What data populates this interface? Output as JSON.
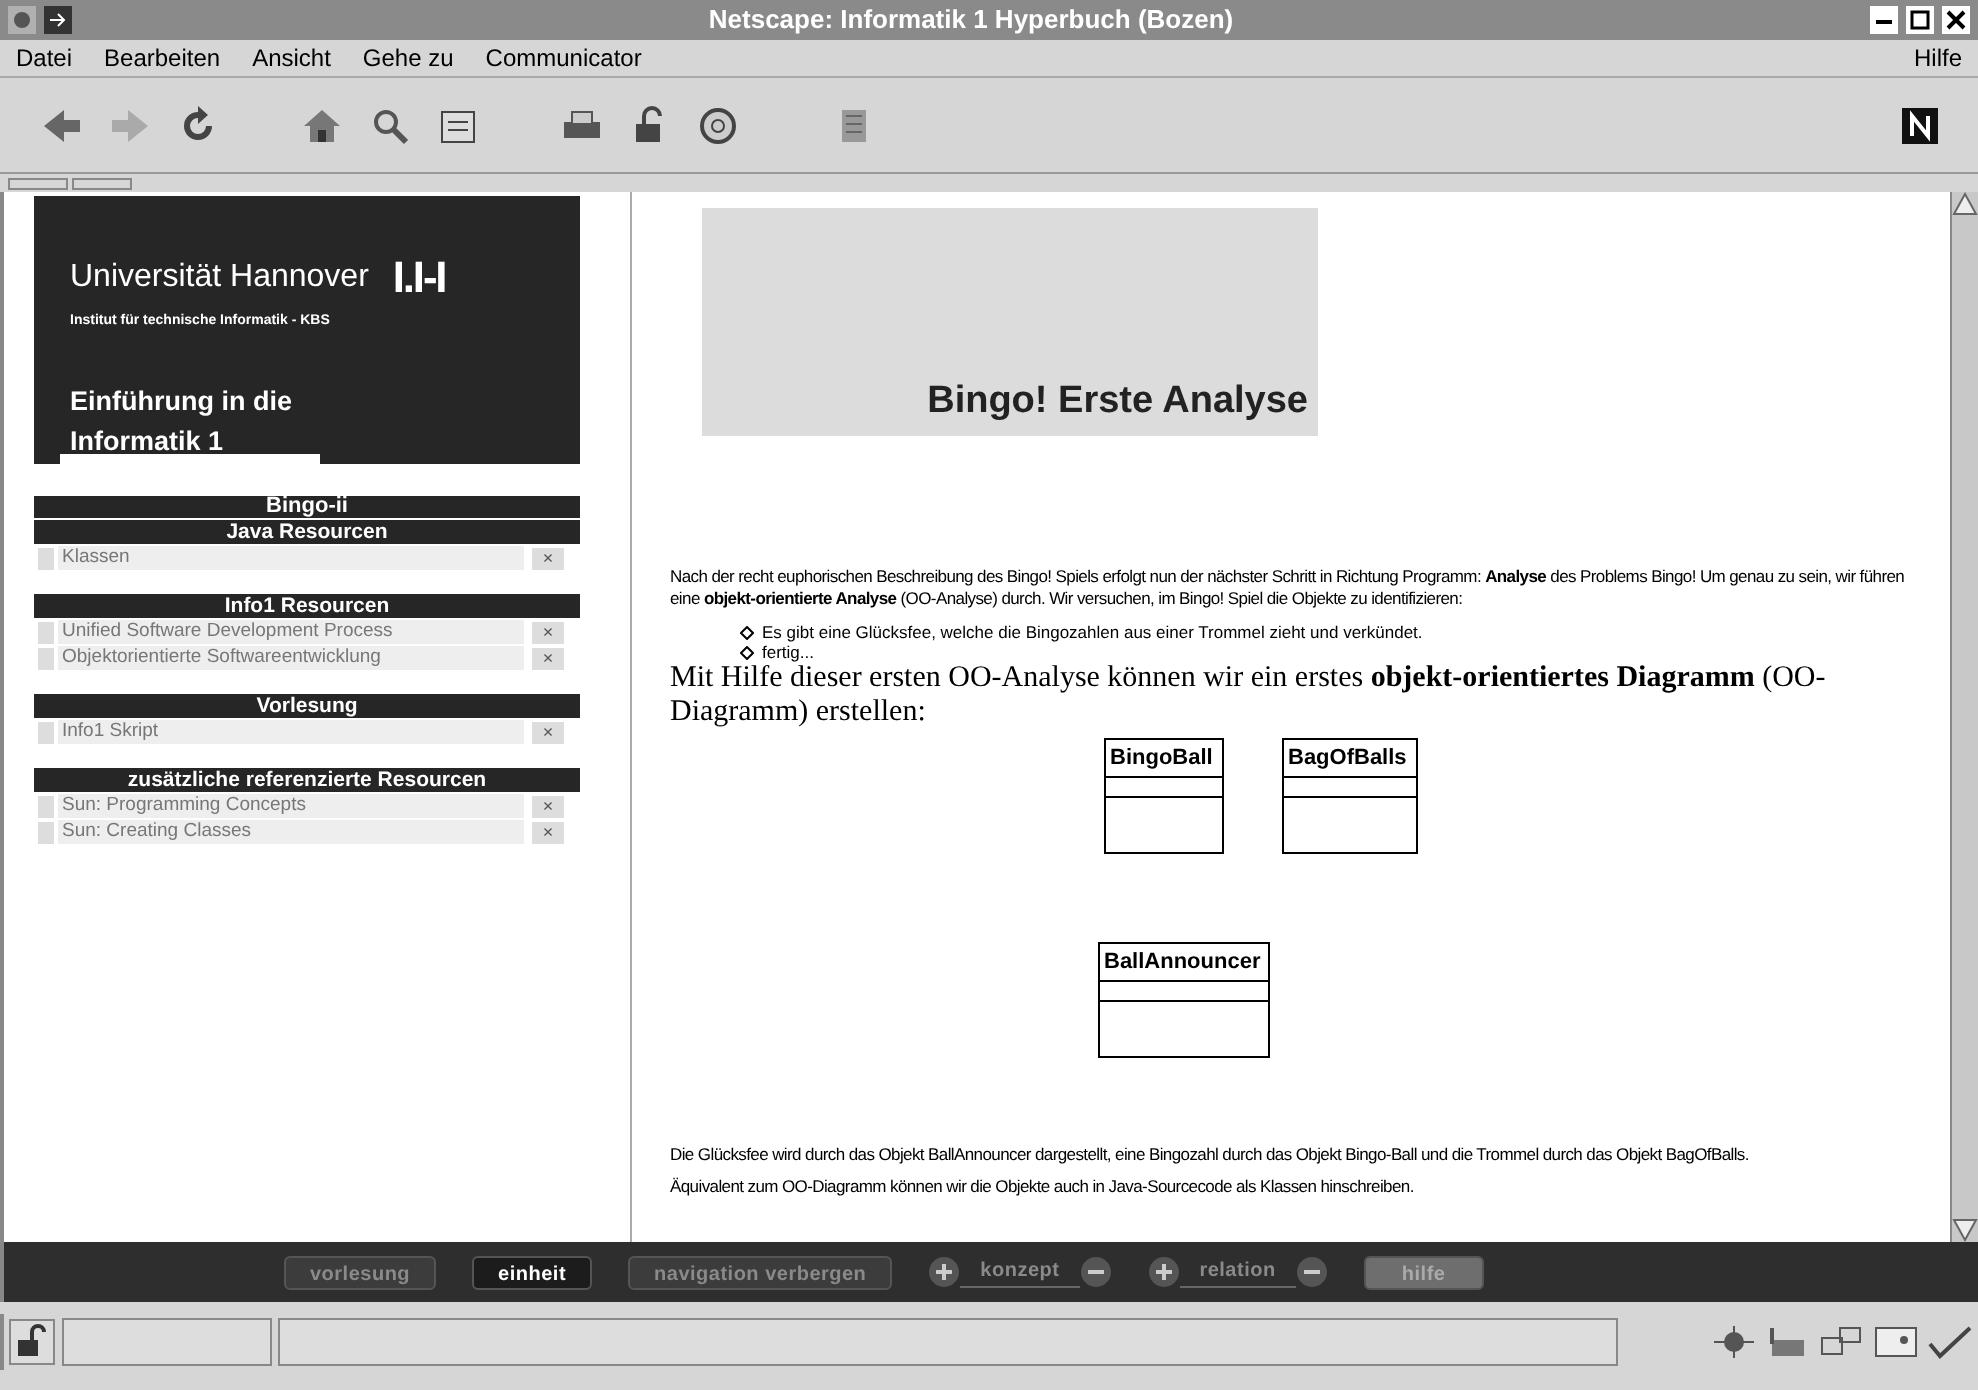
{
  "window": {
    "title": "Netscape: Informatik 1 Hyperbuch (Bozen)"
  },
  "menu": [
    {
      "label": "Datei"
    },
    {
      "label": "Bearbeiten"
    },
    {
      "label": "Ansicht"
    },
    {
      "label": "Gehe zu"
    },
    {
      "label": "Communicator"
    }
  ],
  "help_menu": "Hilfe",
  "sidebar": {
    "university": "Universität Hannover",
    "logo": "I.I-I",
    "institute": "Institut für technische Informatik - KBS",
    "course": [
      "Einführung in die",
      "Informatik 1"
    ],
    "title": "Bingo-ii",
    "sections": [
      {
        "title": "Java Resourcen",
        "items": [
          {
            "label": "Klassen",
            "close": "×"
          }
        ]
      },
      {
        "title": "Info1 Resourcen",
        "items": [
          {
            "label": "Unified Software Development Process",
            "close": "×"
          },
          {
            "label": "Objektorientierte Softwareentwicklung",
            "close": "×"
          }
        ]
      },
      {
        "title": "Vorlesung",
        "items": [
          {
            "label": "Info1 Skript",
            "close": "×"
          }
        ]
      },
      {
        "title": "zusätzliche referenzierte Resourcen",
        "items": [
          {
            "label": "Sun: Programming Concepts",
            "close": "×"
          },
          {
            "label": "Sun: Creating Classes",
            "close": "×"
          }
        ]
      }
    ]
  },
  "content": {
    "heading": "Bingo! Erste Analyse",
    "intro": "Nach der recht euphorischen Beschreibung des Bingo! Spiels erfolgt nun der nächster Schritt in Richtung Programm: **Analyse** des Problems Bingo! Um genau zu sein, wir führen eine **objekt-orientierte Analyse** (OO-Analyse) durch. Wir versuchen, im Bingo! Spiel die Objekte zu identifizieren:",
    "bullets": [
      "Es gibt eine Glücksfee, welche die Bingozahlen aus einer Trommel zieht und verkündet.",
      "fertig..."
    ],
    "diagram_intro": "Mit Hilfe dieser ersten OO-Analyse können wir ein erstes **objekt-orientiertes Diagramm** (OO-Diagramm) erstellen:",
    "classes": [
      "BingoBall",
      "BagOfBalls",
      "BallAnnouncer"
    ],
    "outro": "Die Glücksfee wird durch das Objekt BallAnnouncer dargestellt, eine Bingozahl durch das Objekt Bingo-Ball und die Trommel durch das Objekt BagOfBalls.",
    "next": "Äquivalent zum OO-Diagramm können wir die Objekte auch in Java-Sourcecode als Klassen hinschreiben."
  },
  "navbar": [
    {
      "kind": "button",
      "label": "vorlesung",
      "selected": false
    },
    {
      "kind": "button",
      "label": "einheit",
      "selected": true
    },
    {
      "kind": "button",
      "label": "navigation verbergen",
      "selected": false
    },
    {
      "kind": "stepper",
      "label": "konzept",
      "selected": false
    },
    {
      "kind": "stepper",
      "label": "relation",
      "selected": false
    },
    {
      "kind": "button",
      "label": "hilfe",
      "selected": false,
      "disabled": true
    }
  ]
}
